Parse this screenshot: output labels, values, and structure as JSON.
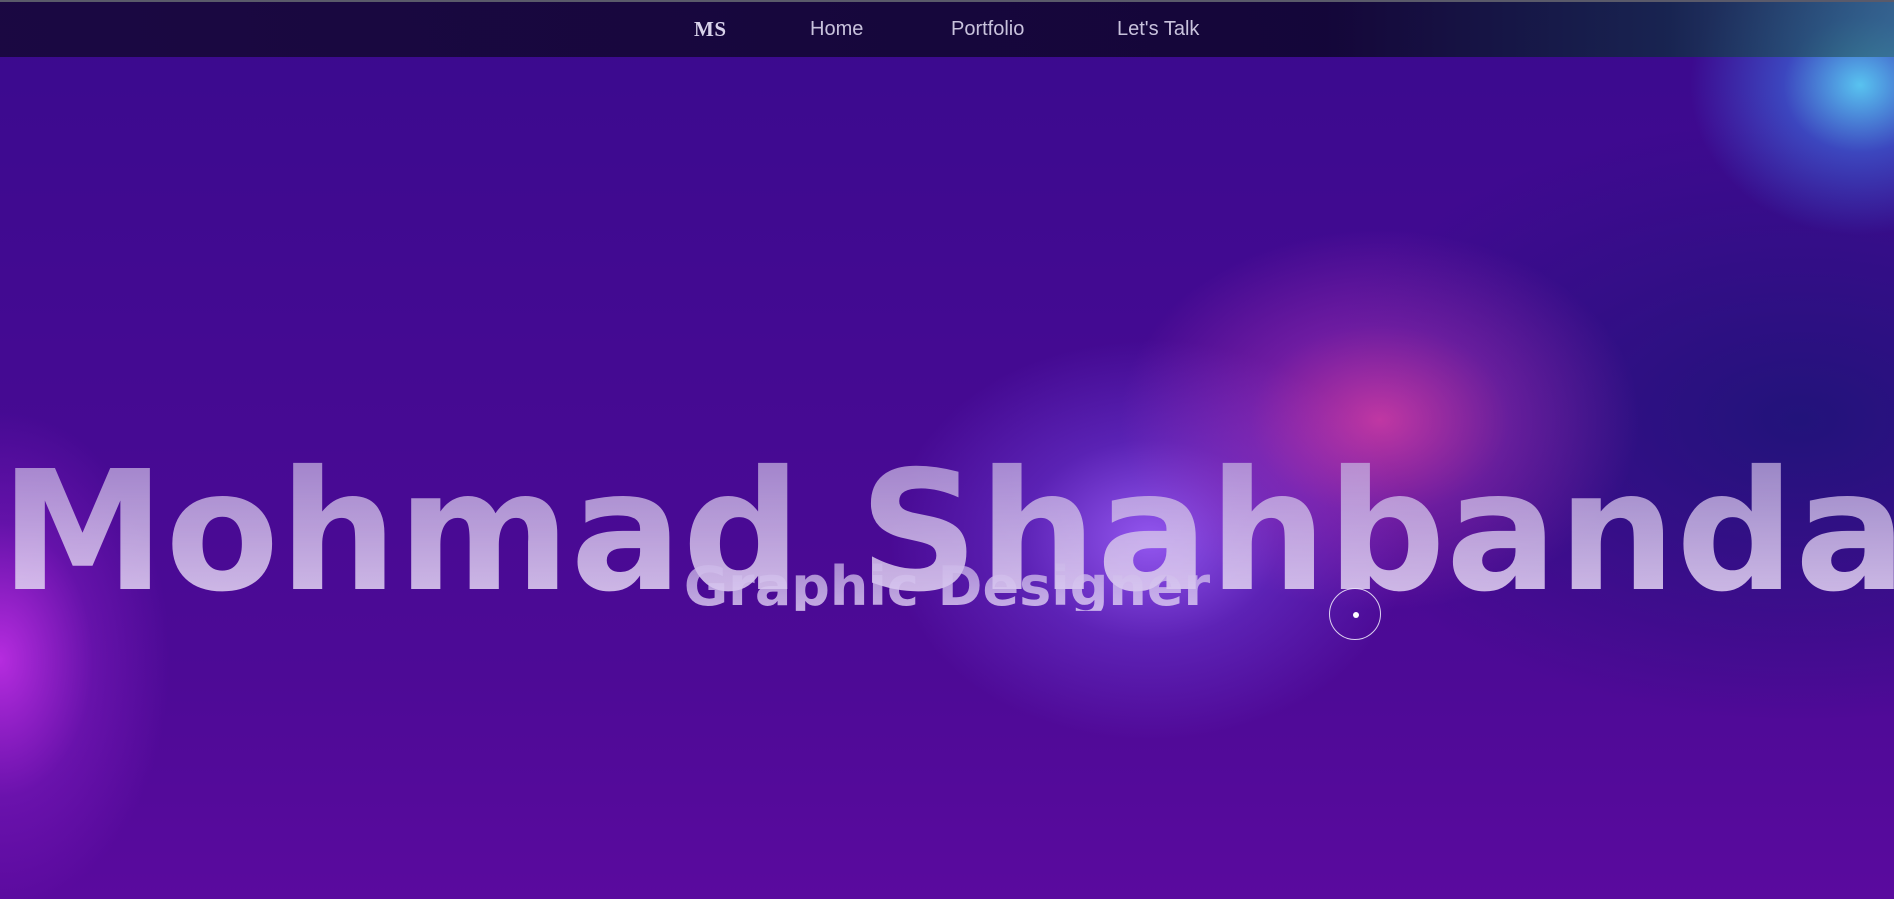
{
  "nav": {
    "logo": "MS",
    "items": [
      {
        "label": "Home"
      },
      {
        "label": "Portfolio"
      },
      {
        "label": "Let's Talk"
      }
    ]
  },
  "hero": {
    "title": "Mohmad Shahbandar",
    "subtitle": "Graphic Designer"
  },
  "colors": {
    "background_base": "#440a92",
    "glow_cyan": "#5acdf5",
    "glow_pink": "#eb46aa",
    "glow_violet": "#a064ff",
    "glow_magenta": "#c832eb",
    "nav_text": "#c8c2dc"
  },
  "icons": {
    "cursor": "custom-cursor-ring"
  }
}
